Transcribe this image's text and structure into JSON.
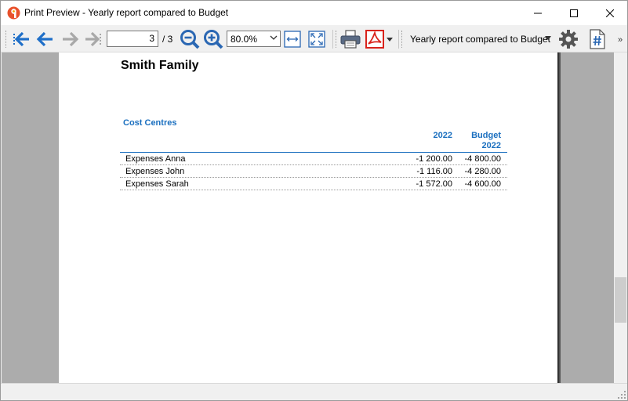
{
  "window": {
    "title": "Print Preview - Yearly report compared to Budget"
  },
  "toolbar": {
    "page_current": "3",
    "page_total": "/ 3",
    "zoom_value": "80.0%",
    "report_selector": "Yearly report compared to Budget",
    "overflow": "»",
    "icons": [
      "first-page-icon",
      "previous-page-icon",
      "next-page-icon",
      "last-page-icon",
      "zoom-out-icon",
      "zoom-in-icon",
      "fit-width-icon",
      "fit-page-icon",
      "print-icon",
      "pdf-icon",
      "settings-icon",
      "page-number-icon"
    ]
  },
  "report": {
    "company": "Smith Family",
    "section_title": "Cost Centres",
    "columns": {
      "year": "2022",
      "budget_line1": "Budget",
      "budget_line2": "2022"
    },
    "rows": [
      {
        "label": "Expenses Anna",
        "year": "-1 200.00",
        "budget": "-4 800.00"
      },
      {
        "label": "Expenses John",
        "year": "-1 116.00",
        "budget": "-4 280.00"
      },
      {
        "label": "Expenses Sarah",
        "year": "-1 572.00",
        "budget": "-4 600.00"
      }
    ]
  },
  "colors": {
    "accent_blue": "#1a6fbf",
    "nav_blue": "#1f6fc8",
    "pdf_red": "#d9231c"
  }
}
